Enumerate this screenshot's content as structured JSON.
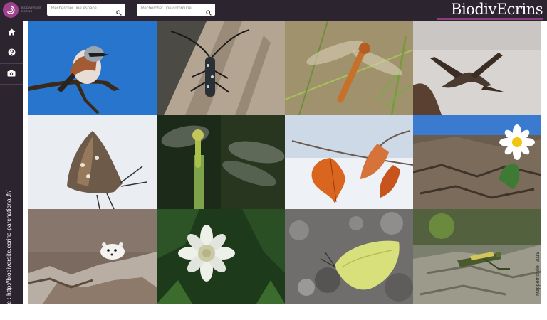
{
  "header": {
    "logo_text": "BIODIVERSITÉ ECRINS",
    "search_species_placeholder": "Rechercher une espèce",
    "search_commune_placeholder": "Rechercher une commune",
    "brand": "BiodivEcrins"
  },
  "sidebar": {
    "items": [
      {
        "icon": "home-icon"
      },
      {
        "icon": "help-icon"
      },
      {
        "icon": "camera-icon"
      }
    ]
  },
  "caption": {
    "source": "Source : http://biodiversite.ecrins-parcnational.fr/",
    "credit": "Mappemonde, 2018"
  },
  "gallery": {
    "photos": [
      {
        "subject": "red-backed shrike on branch"
      },
      {
        "subject": "longhorn beetle on bark"
      },
      {
        "subject": "dragonfly on reeds"
      },
      {
        "subject": "bird in flight over snow"
      },
      {
        "subject": "painted lady butterfly"
      },
      {
        "subject": "damselfly on stem"
      },
      {
        "subject": "autumn leaves on twig"
      },
      {
        "subject": "white daisy on rocks"
      },
      {
        "subject": "ermine on rocks"
      },
      {
        "subject": "white alpine flower"
      },
      {
        "subject": "brimstone butterfly"
      },
      {
        "subject": "grasshopper on rock"
      }
    ]
  }
}
